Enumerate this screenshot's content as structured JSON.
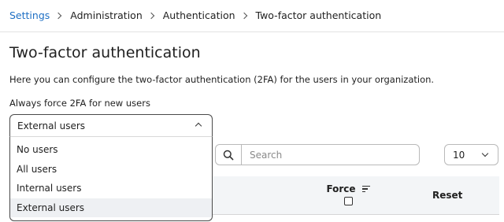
{
  "breadcrumb": {
    "items": [
      "Settings",
      "Administration",
      "Authentication",
      "Two-factor authentication"
    ]
  },
  "page": {
    "title": "Two-factor authentication",
    "description": "Here you can configure the two-factor authentication (2FA) for the users in your organization."
  },
  "force_2fa": {
    "label": "Always force 2FA for new users",
    "selected": "External users",
    "options": [
      "No users",
      "All users",
      "Internal users",
      "External users"
    ]
  },
  "search": {
    "placeholder": "Search",
    "icon": "search-icon"
  },
  "page_size": {
    "value": "10"
  },
  "table": {
    "columns": {
      "force": "Force",
      "reset": "Reset"
    }
  },
  "colors": {
    "link": "#1e6fc4",
    "selected_option_bg": "#eef0f3",
    "table_header_bg": "#f3f5f7"
  }
}
